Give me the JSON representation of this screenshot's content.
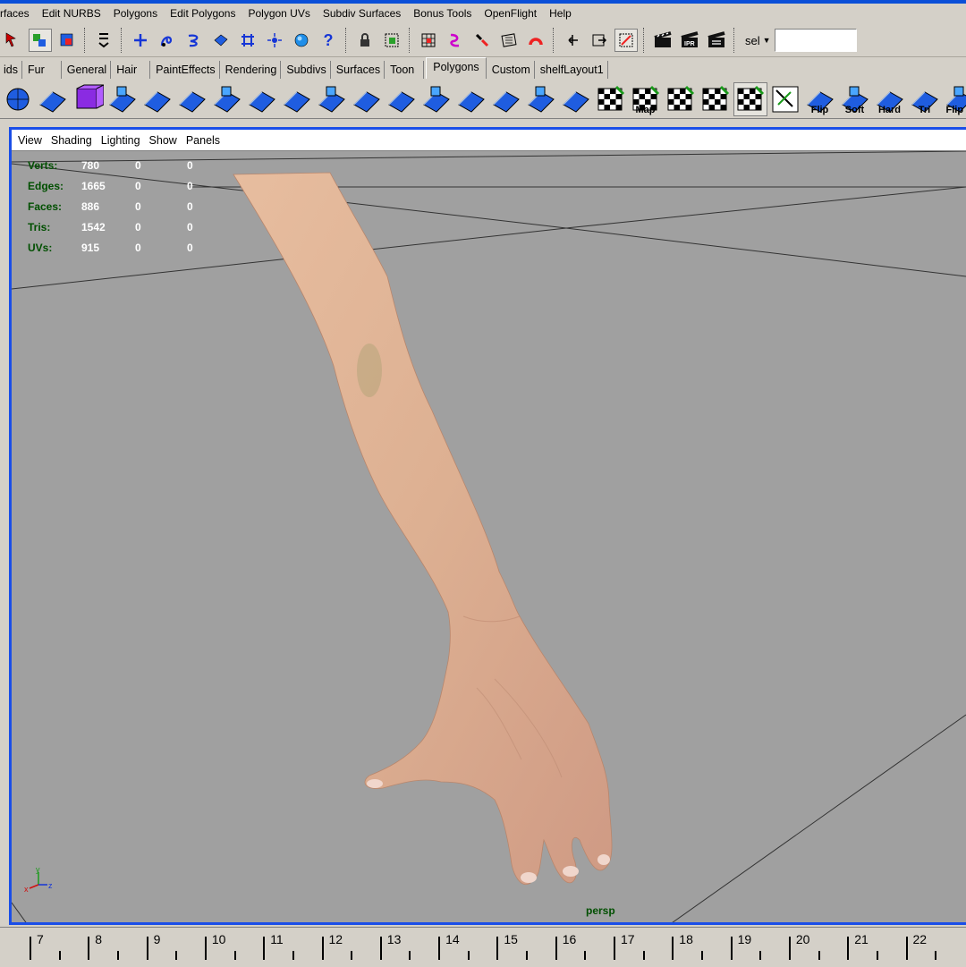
{
  "menubar": {
    "items": [
      "rfaces",
      "Edit NURBS",
      "Polygons",
      "Edit Polygons",
      "Polygon UVs",
      "Subdiv Surfaces",
      "Bonus Tools",
      "OpenFlight",
      "Help"
    ]
  },
  "statusline": {
    "icons": [
      "select-tool-icon",
      "select-by-hierarchy-icon",
      "select-by-object-type-icon",
      "menu-set-icon",
      "snap-to-grid-icon",
      "snap-to-curve-icon",
      "snap-to-point-icon",
      "snap-to-view-plane-icon",
      "make-live-icon",
      "construction-history-icon",
      "render-icon",
      "help-icon",
      "lock-icon",
      "selection-mask-icon",
      "show-manipulator-icon",
      "soft-select-icon",
      "magnet-icon",
      "input-icon",
      "output-icon",
      "construction-icon",
      "render-frame-icon",
      "ipr-render-icon",
      "render-settings-icon"
    ],
    "sel_label": "sel",
    "sel_value": ""
  },
  "shelf_tabs": {
    "items": [
      "ids",
      "Fur",
      "General",
      "Hair",
      "PaintEffects",
      "Rendering",
      "Subdivs",
      "Surfaces",
      "Toon",
      "Polygons",
      "Custom",
      "shelfLayout1"
    ],
    "active": "Polygons"
  },
  "shelf_icons": {
    "items": [
      {
        "name": "poly-sphere-icon",
        "label": ""
      },
      {
        "name": "poly-cube-icon",
        "label": ""
      },
      {
        "name": "poly-cube-wire-icon",
        "label": ""
      },
      {
        "name": "poly-plane-icon",
        "label": ""
      },
      {
        "name": "poly-select-icon",
        "label": ""
      },
      {
        "name": "poly-extrude-icon",
        "label": ""
      },
      {
        "name": "poly-split-icon",
        "label": ""
      },
      {
        "name": "poly-bevel-icon",
        "label": ""
      },
      {
        "name": "poly-wedge-icon",
        "label": ""
      },
      {
        "name": "poly-merge-icon",
        "label": ""
      },
      {
        "name": "poly-smooth-icon",
        "label": ""
      },
      {
        "name": "poly-subdiv-icon",
        "label": ""
      },
      {
        "name": "poly-combine-icon",
        "label": ""
      },
      {
        "name": "poly-separate-icon",
        "label": ""
      },
      {
        "name": "poly-triangulate-icon",
        "label": ""
      },
      {
        "name": "poly-quadrangulate-icon",
        "label": ""
      },
      {
        "name": "poly-center-pivot-icon",
        "label": ""
      },
      {
        "name": "planar-map-icon",
        "label": ""
      },
      {
        "name": "auto-map-icon",
        "label": "Map"
      },
      {
        "name": "cylindrical-map-icon",
        "label": ""
      },
      {
        "name": "spherical-map-icon",
        "label": ""
      },
      {
        "name": "uv-texture-editor-icon",
        "label": ""
      },
      {
        "name": "uv-layout-icon",
        "label": ""
      },
      {
        "name": "flip-normals-icon",
        "label": "Flip"
      },
      {
        "name": "soften-edge-icon",
        "label": "Soft"
      },
      {
        "name": "harden-edge-icon",
        "label": "Hard"
      },
      {
        "name": "triangulate-icon",
        "label": "Tri"
      },
      {
        "name": "flip-edge-icon",
        "label": "Flip E"
      }
    ]
  },
  "panel": {
    "menu": [
      "View",
      "Shading",
      "Lighting",
      "Show",
      "Panels"
    ],
    "camera": "persp"
  },
  "hud": {
    "rows": [
      {
        "label": "Verts:",
        "value": "780",
        "sel": "0",
        "comp": "0"
      },
      {
        "label": "Edges:",
        "value": "1665",
        "sel": "0",
        "comp": "0"
      },
      {
        "label": "Faces:",
        "value": "886",
        "sel": "0",
        "comp": "0"
      },
      {
        "label": "Tris:",
        "value": "1542",
        "sel": "0",
        "comp": "0"
      },
      {
        "label": "UVs:",
        "value": "915",
        "sel": "0",
        "comp": "0"
      }
    ]
  },
  "axis": {
    "x": "x",
    "y": "y",
    "z": "z"
  },
  "timeline": {
    "labels": [
      "7",
      "8",
      "9",
      "10",
      "11",
      "12",
      "13",
      "14",
      "15",
      "16",
      "17",
      "18",
      "19",
      "20",
      "21",
      "22"
    ]
  },
  "colors": {
    "accent": "#1a4ee8",
    "viewport": "#a0a0a0",
    "hud_label": "#004f00",
    "skin": "#d9a98e"
  }
}
